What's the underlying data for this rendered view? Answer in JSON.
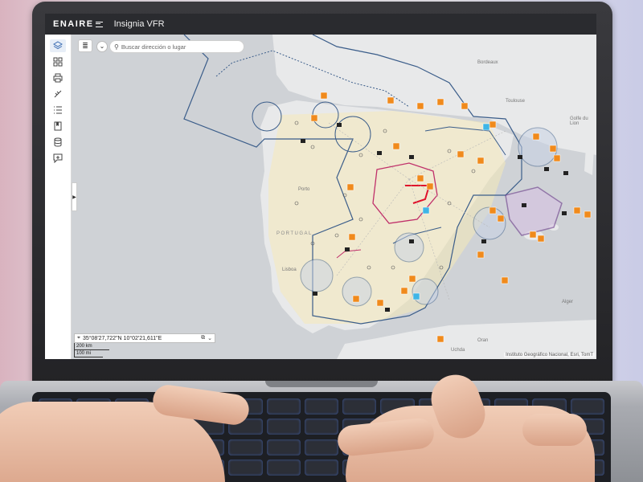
{
  "app": {
    "brand": "ENAIRE",
    "title": "Insignia VFR"
  },
  "search": {
    "placeholder": "Buscar dirección o lugar"
  },
  "toolbar": {
    "items": [
      {
        "name": "layers",
        "icon": "layers-icon"
      },
      {
        "name": "grid",
        "icon": "grid-icon"
      },
      {
        "name": "print",
        "icon": "printer-icon"
      },
      {
        "name": "measure",
        "icon": "measure-icon"
      },
      {
        "name": "list",
        "icon": "list-icon"
      },
      {
        "name": "bookmark",
        "icon": "bookmark-icon"
      },
      {
        "name": "database",
        "icon": "database-icon"
      },
      {
        "name": "add-note",
        "icon": "add-note-icon"
      }
    ]
  },
  "map": {
    "coordinates": "35°08'27,722\"N 10°02'21,611\"E",
    "scale_km": "200 km",
    "scale_mi": "100 mi",
    "attribution": "Instituto Geográfico Nacional, Esri, TomT",
    "labels": {
      "bordeaux": "Bordeaux",
      "toulouse": "Toulouse",
      "golfo": "Golfe du\nLion",
      "porto": "Porto",
      "portugal": "PORTUGAL",
      "lisboa": "Lisboa",
      "alger": "Alger",
      "oran": "Oran",
      "uchda": "Uchda"
    },
    "colors": {
      "land": "#e8e9ea",
      "sea": "#cfd2d6",
      "fir": "#3b5d8a",
      "ctr": "#c0306a",
      "marker": "#f08a1c",
      "marker_blue": "#3fb5e6"
    }
  }
}
